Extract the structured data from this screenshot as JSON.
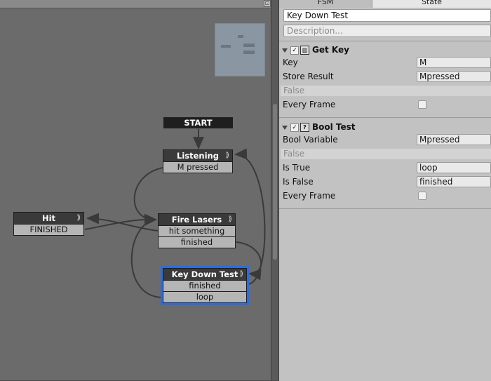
{
  "graph": {
    "scroll_button_glyph": "⊡",
    "start_label": "START",
    "states": [
      {
        "id": "listening",
        "title": "Listening",
        "events": [
          "M pressed"
        ]
      },
      {
        "id": "hit",
        "title": "Hit",
        "events": [
          "FINISHED"
        ]
      },
      {
        "id": "fire",
        "title": "Fire Lasers",
        "events": [
          "hit something",
          "finished"
        ]
      },
      {
        "id": "keydown",
        "title": "Key Down Test",
        "events": [
          "finished",
          "loop"
        ],
        "selected": true
      }
    ],
    "chevron": "⟫",
    "wire_color": "#3a3a3a"
  },
  "inspector": {
    "tabs": [
      "FSM",
      "State"
    ],
    "active_tab": "State",
    "state_name": "Key Down Test",
    "description_placeholder": "Description...",
    "actions": [
      {
        "name": "Get Key",
        "enabled": true,
        "params": [
          {
            "label": "Key",
            "value": "M"
          },
          {
            "label": "Store Result",
            "value": "Mpressed"
          }
        ],
        "false_label": "False",
        "every_frame_label": "Every Frame"
      },
      {
        "name": "Bool Test",
        "enabled": true,
        "params": [
          {
            "label": "Bool Variable",
            "value": "Mpressed"
          }
        ],
        "false_label": "False",
        "events": [
          {
            "label": "Is True",
            "value": "loop"
          },
          {
            "label": "Is False",
            "value": "finished"
          }
        ],
        "every_frame_label": "Every Frame"
      }
    ]
  },
  "colors": {
    "canvas": "#6b6b6b",
    "inspector": "#c2c2c2",
    "selection": "#2a6ce0"
  }
}
